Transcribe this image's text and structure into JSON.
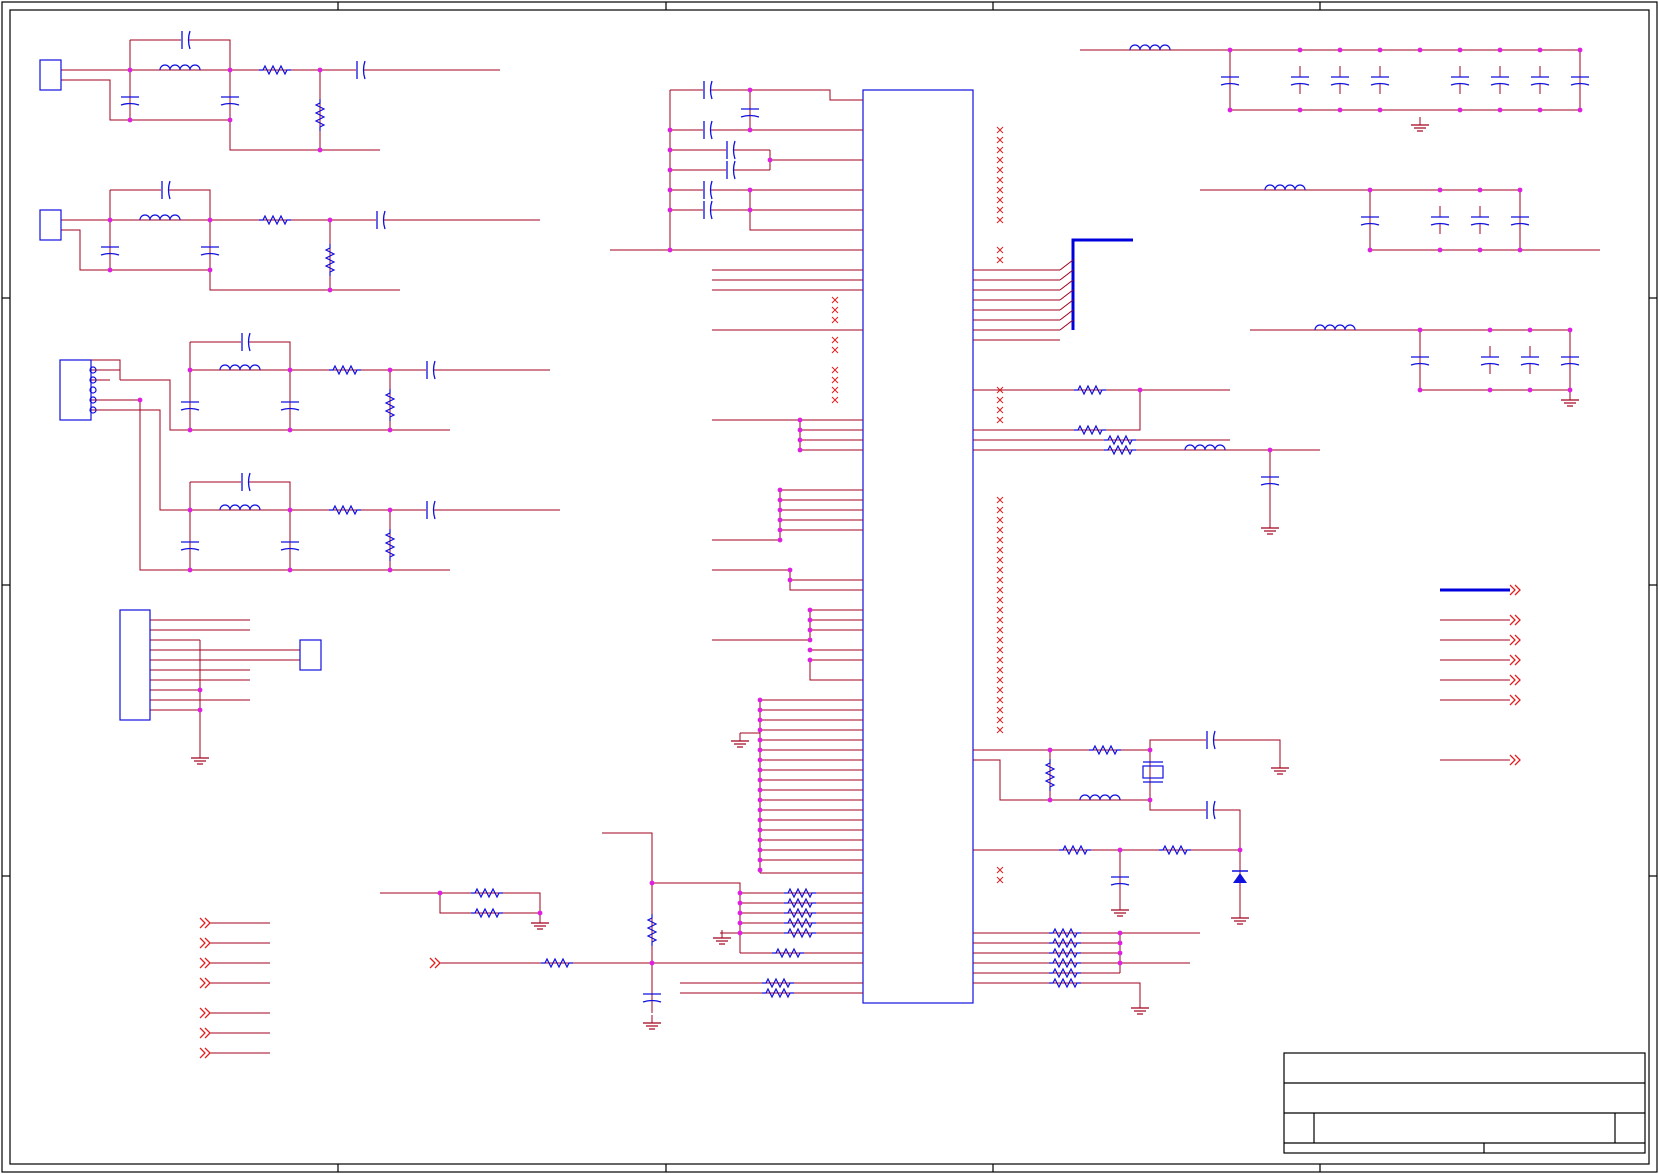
{
  "sheet": {
    "zone_columns": [
      "",
      "",
      "",
      "",
      ""
    ],
    "zone_rows": [
      "",
      "",
      "",
      ""
    ],
    "title_block": {
      "title": "",
      "subtitle": "",
      "size": "",
      "document_number": "",
      "revision": "",
      "date": "",
      "sheet": ""
    }
  },
  "colors": {
    "wire": "#a0001c",
    "component": "#1010e0",
    "junction": "#e020e0",
    "no_connect": "#e02020",
    "frame": "#000000",
    "bus": "#0000dd"
  },
  "icons": {
    "resistor": "resistor-icon",
    "capacitor": "capacitor-icon",
    "inductor": "inductor-icon",
    "ground": "ground-icon",
    "diode": "diode-icon",
    "crystal": "crystal-icon",
    "connector": "connector-icon",
    "off_page_connector": "off-page-connector-icon",
    "no_connect": "no-connect-icon",
    "main_ic": "ic-package-icon"
  }
}
